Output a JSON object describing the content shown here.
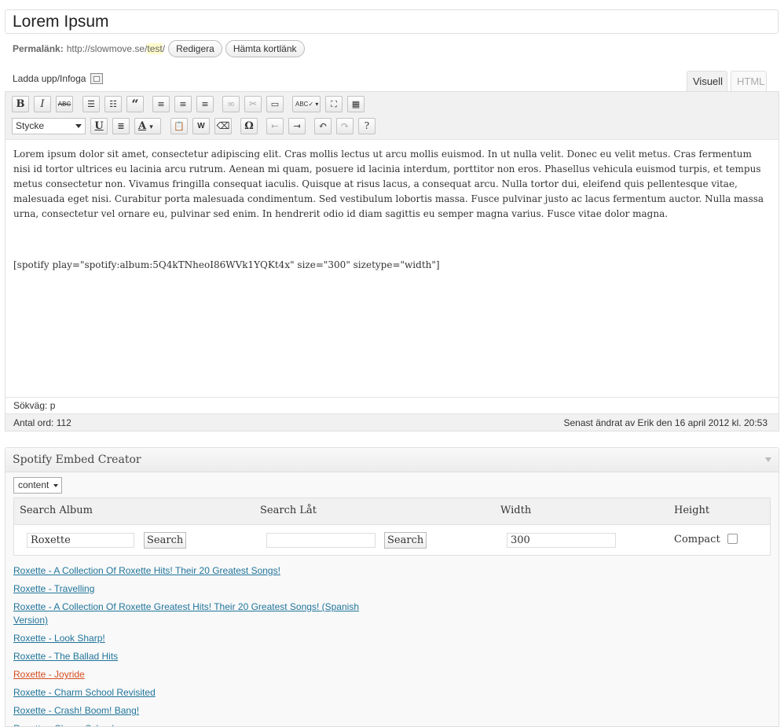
{
  "post": {
    "title": "Lorem Ipsum",
    "permalink_label": "Permalänk:",
    "permalink_base": "http://slowmove.se/",
    "permalink_slug": "test",
    "permalink_end": "/",
    "edit_button": "Redigera",
    "shortlink_button": "Hämta kortlänk"
  },
  "editor": {
    "upload_label": "Ladda upp/Infoga",
    "tab_visual": "Visuell",
    "tab_html": "HTML",
    "format_select": "Stycke",
    "paragraph": "Lorem ipsum dolor sit amet, consectetur adipiscing elit. Cras mollis lectus ut arcu mollis euismod. In ut nulla velit. Donec eu velit metus. Cras fermentum nisi id tortor ultrices eu lacinia arcu rutrum. Aenean mi quam, posuere id lacinia interdum, porttitor non eros. Phasellus vehicula euismod turpis, et tempus metus consectetur non. Vivamus fringilla consequat iaculis. Quisque at risus lacus, a consequat arcu. Nulla tortor dui, eleifend quis pellentesque vitae, malesuada eget nisi. Curabitur porta malesuada condimentum. Sed vestibulum lobortis massa. Fusce pulvinar justo ac lacus fermentum auctor. Nulla massa urna, consectetur vel ornare eu, pulvinar sed enim. In hendrerit odio id diam sagittis eu semper magna varius. Fusce vitae dolor magna.",
    "shortcode": "[spotify play=\"spotify:album:5Q4kTNheoI86WVk1YQKt4x\" size=\"300\" sizetype=\"width\"]",
    "path_label": "Sökväg:",
    "path_value": "p",
    "word_count": "Antal ord: 112",
    "last_edited": "Senast ändrat av Erik den 16 april 2012 kl. 20:53",
    "toolbar_row1": [
      "bold-icon",
      "italic-icon",
      "strikethrough-icon",
      "bullet-list-icon",
      "numbered-list-icon",
      "blockquote-icon",
      "align-left-icon",
      "align-center-icon",
      "align-right-icon",
      "link-icon",
      "unlink-icon",
      "more-tag-icon",
      "spellcheck-icon",
      "fullscreen-icon",
      "kitchen-sink-icon"
    ],
    "toolbar_row2": [
      "underline-icon",
      "justify-icon",
      "text-color-icon",
      "paste-text-icon",
      "paste-word-icon",
      "clear-format-icon",
      "special-char-icon",
      "outdent-icon",
      "indent-icon",
      "undo-icon",
      "redo-icon",
      "help-icon"
    ]
  },
  "spotify": {
    "title": "Spotify Embed Creator",
    "context_select": "content",
    "col_album": "Search Album",
    "col_track": "Search Låt",
    "col_width": "Width",
    "col_height": "Height",
    "album_query": "Roxette",
    "track_query": "",
    "search_label": "Search",
    "width_value": "300",
    "compact_label": "Compact",
    "results": [
      "Roxette - A Collection Of Roxette Hits! Their 20 Greatest Songs!",
      "Roxette - Travelling",
      "Roxette - A Collection Of Roxette Greatest Hits! Their 20 Greatest Songs! (Spanish Version)",
      "Roxette - Look Sharp!",
      "Roxette - The Ballad Hits",
      "Roxette - Joyride",
      "Roxette - Charm School Revisited",
      "Roxette - Crash! Boom! Bang!",
      "Roxette - Charm School"
    ],
    "active_result": 5
  }
}
